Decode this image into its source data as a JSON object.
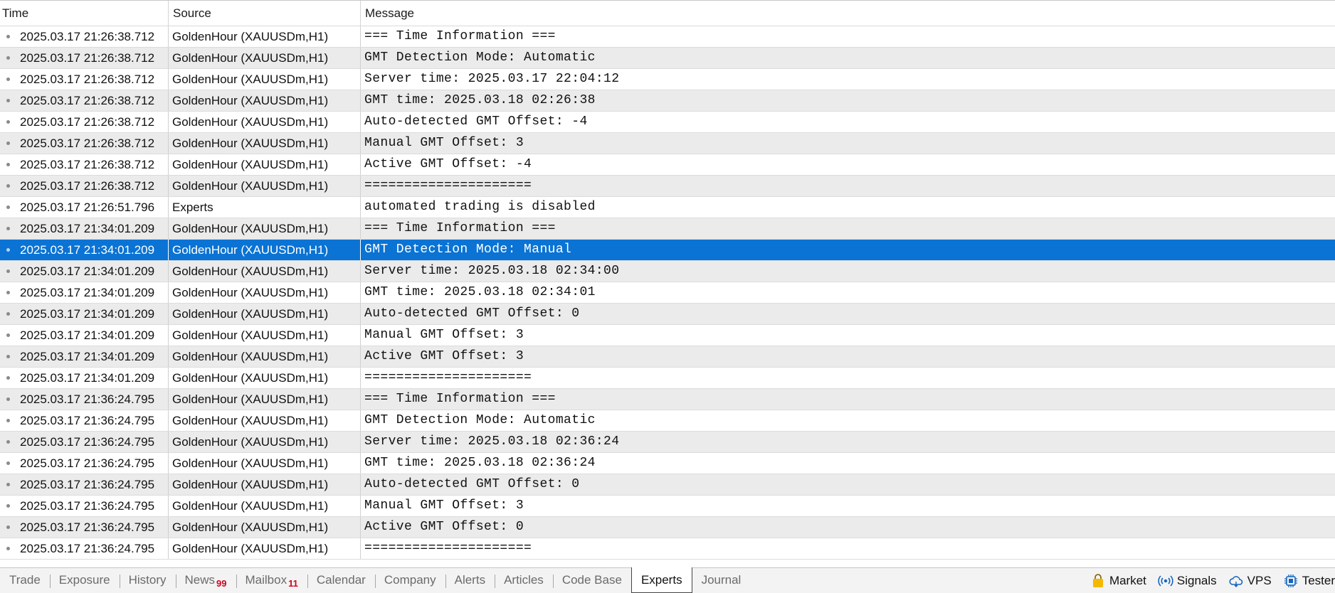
{
  "columns": {
    "time": "Time",
    "source": "Source",
    "message": "Message"
  },
  "rows": [
    {
      "time": "2025.03.17 21:26:38.712",
      "source": "GoldenHour (XAUUSDm,H1)",
      "message": "=== Time Information ==="
    },
    {
      "time": "2025.03.17 21:26:38.712",
      "source": "GoldenHour (XAUUSDm,H1)",
      "message": "GMT Detection Mode: Automatic"
    },
    {
      "time": "2025.03.17 21:26:38.712",
      "source": "GoldenHour (XAUUSDm,H1)",
      "message": "Server time: 2025.03.17 22:04:12"
    },
    {
      "time": "2025.03.17 21:26:38.712",
      "source": "GoldenHour (XAUUSDm,H1)",
      "message": "GMT time: 2025.03.18 02:26:38"
    },
    {
      "time": "2025.03.17 21:26:38.712",
      "source": "GoldenHour (XAUUSDm,H1)",
      "message": "Auto-detected GMT Offset: -4"
    },
    {
      "time": "2025.03.17 21:26:38.712",
      "source": "GoldenHour (XAUUSDm,H1)",
      "message": "Manual GMT Offset: 3"
    },
    {
      "time": "2025.03.17 21:26:38.712",
      "source": "GoldenHour (XAUUSDm,H1)",
      "message": "Active GMT Offset: -4"
    },
    {
      "time": "2025.03.17 21:26:38.712",
      "source": "GoldenHour (XAUUSDm,H1)",
      "message": "====================="
    },
    {
      "time": "2025.03.17 21:26:51.796",
      "source": "Experts",
      "message": "automated trading is disabled"
    },
    {
      "time": "2025.03.17 21:34:01.209",
      "source": "GoldenHour (XAUUSDm,H1)",
      "message": "=== Time Information ==="
    },
    {
      "time": "2025.03.17 21:34:01.209",
      "source": "GoldenHour (XAUUSDm,H1)",
      "message": "GMT Detection Mode: Manual",
      "selected": true
    },
    {
      "time": "2025.03.17 21:34:01.209",
      "source": "GoldenHour (XAUUSDm,H1)",
      "message": "Server time: 2025.03.18 02:34:00"
    },
    {
      "time": "2025.03.17 21:34:01.209",
      "source": "GoldenHour (XAUUSDm,H1)",
      "message": "GMT time: 2025.03.18 02:34:01"
    },
    {
      "time": "2025.03.17 21:34:01.209",
      "source": "GoldenHour (XAUUSDm,H1)",
      "message": "Auto-detected GMT Offset: 0"
    },
    {
      "time": "2025.03.17 21:34:01.209",
      "source": "GoldenHour (XAUUSDm,H1)",
      "message": "Manual GMT Offset: 3"
    },
    {
      "time": "2025.03.17 21:34:01.209",
      "source": "GoldenHour (XAUUSDm,H1)",
      "message": "Active GMT Offset: 3"
    },
    {
      "time": "2025.03.17 21:34:01.209",
      "source": "GoldenHour (XAUUSDm,H1)",
      "message": "====================="
    },
    {
      "time": "2025.03.17 21:36:24.795",
      "source": "GoldenHour (XAUUSDm,H1)",
      "message": "=== Time Information ==="
    },
    {
      "time": "2025.03.17 21:36:24.795",
      "source": "GoldenHour (XAUUSDm,H1)",
      "message": "GMT Detection Mode: Automatic"
    },
    {
      "time": "2025.03.17 21:36:24.795",
      "source": "GoldenHour (XAUUSDm,H1)",
      "message": "Server time: 2025.03.18 02:36:24"
    },
    {
      "time": "2025.03.17 21:36:24.795",
      "source": "GoldenHour (XAUUSDm,H1)",
      "message": "GMT time: 2025.03.18 02:36:24"
    },
    {
      "time": "2025.03.17 21:36:24.795",
      "source": "GoldenHour (XAUUSDm,H1)",
      "message": "Auto-detected GMT Offset: 0"
    },
    {
      "time": "2025.03.17 21:36:24.795",
      "source": "GoldenHour (XAUUSDm,H1)",
      "message": "Manual GMT Offset: 3"
    },
    {
      "time": "2025.03.17 21:36:24.795",
      "source": "GoldenHour (XAUUSDm,H1)",
      "message": "Active GMT Offset: 0"
    },
    {
      "time": "2025.03.17 21:36:24.795",
      "source": "GoldenHour (XAUUSDm,H1)",
      "message": "====================="
    }
  ],
  "tabs": [
    {
      "label": "Trade",
      "name": "trade"
    },
    {
      "label": "Exposure",
      "name": "exposure"
    },
    {
      "label": "History",
      "name": "history"
    },
    {
      "label": "News",
      "badge": "99",
      "name": "news"
    },
    {
      "label": "Mailbox",
      "badge": "11",
      "name": "mailbox"
    },
    {
      "label": "Calendar",
      "name": "calendar"
    },
    {
      "label": "Company",
      "name": "company"
    },
    {
      "label": "Alerts",
      "name": "alerts"
    },
    {
      "label": "Articles",
      "name": "articles"
    },
    {
      "label": "Code Base",
      "name": "code-base"
    },
    {
      "label": "Experts",
      "name": "experts",
      "active": true
    },
    {
      "label": "Journal",
      "name": "journal"
    }
  ],
  "tools": [
    {
      "label": "Market",
      "icon": "shopping-bag-icon"
    },
    {
      "label": "Signals",
      "icon": "signal-broadcast-icon"
    },
    {
      "label": "VPS",
      "icon": "cloud-icon"
    },
    {
      "label": "Tester",
      "icon": "chip-icon"
    }
  ],
  "colors": {
    "selected_row": "#0a73d4",
    "badge": "#d0021b",
    "tool_icon": "#1565c0",
    "market_icon": "#f5b800"
  }
}
